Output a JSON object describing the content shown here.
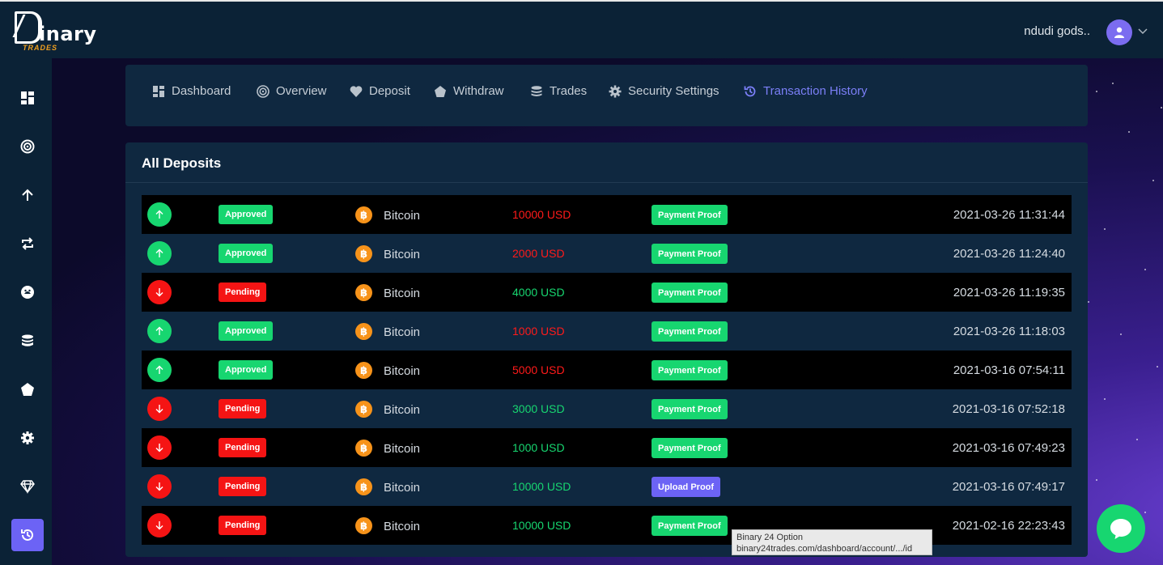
{
  "brand": {
    "name": "inary",
    "sub": "TRADES"
  },
  "user": {
    "name": "ndudi gods.."
  },
  "nav": [
    {
      "label": "Dashboard",
      "icon": "dashboard-icon"
    },
    {
      "label": "Overview",
      "icon": "target-icon"
    },
    {
      "label": "Deposit",
      "icon": "heart-icon"
    },
    {
      "label": "Withdraw",
      "icon": "pentagon-icon"
    },
    {
      "label": "Trades",
      "icon": "database-icon"
    },
    {
      "label": "Security Settings",
      "icon": "gear-icon"
    },
    {
      "label": "Transaction History",
      "icon": "history-icon",
      "active": true
    }
  ],
  "sidebar": [
    "dashboard-icon",
    "target-icon",
    "arrow-up-icon",
    "repeat-icon",
    "smile-icon",
    "database-icon",
    "pentagon-icon",
    "gear-icon",
    "diamond-icon",
    "history-icon"
  ],
  "deposits": {
    "title": "All Deposits",
    "rows": [
      {
        "dir": "up",
        "status": "Approved",
        "coin": "Bitcoin",
        "amount": "10000 USD",
        "amount_color": "red",
        "proof": "Payment Proof",
        "date": "2021-03-26 11:31:44"
      },
      {
        "dir": "up",
        "status": "Approved",
        "coin": "Bitcoin",
        "amount": "2000 USD",
        "amount_color": "red",
        "proof": "Payment Proof",
        "date": "2021-03-26 11:24:40"
      },
      {
        "dir": "down",
        "status": "Pending",
        "coin": "Bitcoin",
        "amount": "4000 USD",
        "amount_color": "green",
        "proof": "Payment Proof",
        "date": "2021-03-26 11:19:35"
      },
      {
        "dir": "up",
        "status": "Approved",
        "coin": "Bitcoin",
        "amount": "1000 USD",
        "amount_color": "red",
        "proof": "Payment Proof",
        "date": "2021-03-26 11:18:03"
      },
      {
        "dir": "up",
        "status": "Approved",
        "coin": "Bitcoin",
        "amount": "5000 USD",
        "amount_color": "red",
        "proof": "Payment Proof",
        "date": "2021-03-16 07:54:11"
      },
      {
        "dir": "down",
        "status": "Pending",
        "coin": "Bitcoin",
        "amount": "3000 USD",
        "amount_color": "green",
        "proof": "Payment Proof",
        "date": "2021-03-16 07:52:18"
      },
      {
        "dir": "down",
        "status": "Pending",
        "coin": "Bitcoin",
        "amount": "1000 USD",
        "amount_color": "green",
        "proof": "Payment Proof",
        "date": "2021-03-16 07:49:23"
      },
      {
        "dir": "down",
        "status": "Pending",
        "coin": "Bitcoin",
        "amount": "10000 USD",
        "amount_color": "green",
        "proof": "Upload Proof",
        "date": "2021-03-16 07:49:17"
      },
      {
        "dir": "down",
        "status": "Pending",
        "coin": "Bitcoin",
        "amount": "10000 USD",
        "amount_color": "green",
        "proof": "Payment Proof",
        "date": "2021-02-16 22:23:43"
      }
    ]
  },
  "tooltip": {
    "title": "Binary 24 Option",
    "url": "binary24trades.com/dashboard/account/.../id"
  },
  "colors": {
    "approved": "#17d670",
    "pending": "#f51414",
    "accent": "#6c63f5",
    "bitcoin": "#f7931a"
  }
}
